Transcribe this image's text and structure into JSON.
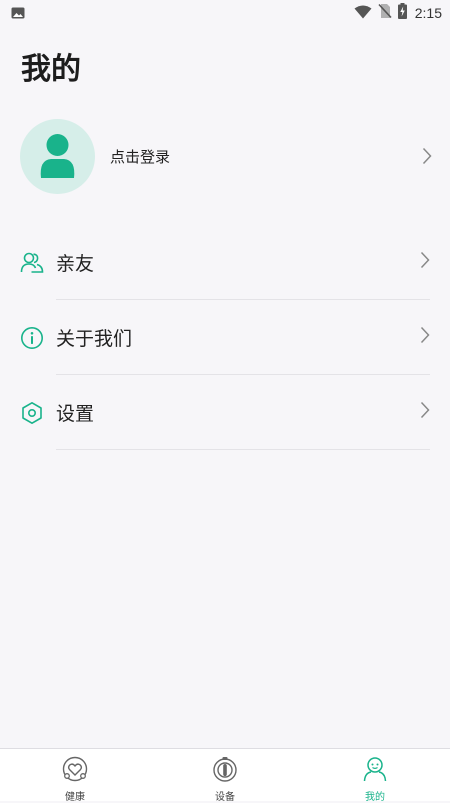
{
  "status_bar": {
    "time": "2:15",
    "icons": [
      "image-icon",
      "wifi-icon",
      "no-sim-icon",
      "battery-charging-icon"
    ]
  },
  "page": {
    "title": "我的"
  },
  "profile": {
    "login_text": "点击登录",
    "avatar_icon": "user-icon"
  },
  "menu": {
    "items": [
      {
        "label": "亲友",
        "icon": "friends-icon"
      },
      {
        "label": "关于我们",
        "icon": "info-icon"
      },
      {
        "label": "设置",
        "icon": "settings-hexagon-icon"
      }
    ]
  },
  "tab_bar": {
    "tabs": [
      {
        "label": "健康",
        "icon": "health-heart-icon",
        "active": false
      },
      {
        "label": "设备",
        "icon": "device-icon",
        "active": false
      },
      {
        "label": "我的",
        "icon": "person-icon",
        "active": true
      }
    ]
  },
  "colors": {
    "accent": "#19b38b",
    "avatar_bg": "#d6eee9",
    "page_bg": "#f7f6f9",
    "divider": "#e4e3e7"
  }
}
